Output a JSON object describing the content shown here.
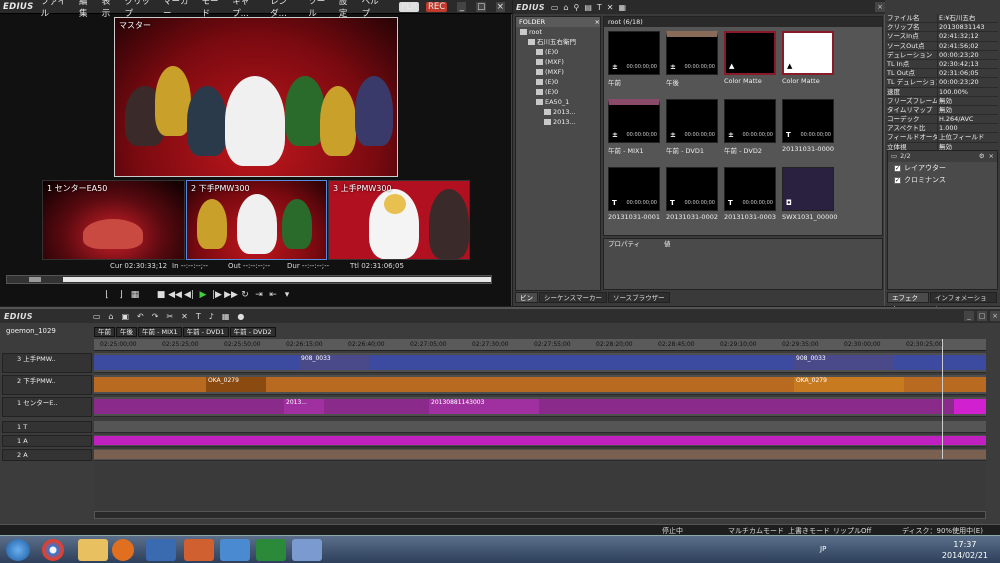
{
  "player": {
    "logo": "EDIUS",
    "menu": [
      "ファイル",
      "編集",
      "表示",
      "クリップ",
      "マーカー",
      "モード",
      "キャプ...",
      "レンダ...",
      "ツール",
      "設定",
      "ヘルプ"
    ],
    "plr": "PLR",
    "rec": "REC",
    "master_label": "マスター",
    "cams": [
      "1 センターEA50",
      "2 下手PMW300",
      "3 上手PMW300"
    ],
    "cur": "Cur 02:30:33;12",
    "in": "In --:--:--;--",
    "out": "Out --:--:--;--",
    "dur": "Dur --:--:--;--",
    "ttl": "Ttl 02:31:06;05"
  },
  "bin": {
    "logo": "EDIUS",
    "folder_title": "FOLDER",
    "tree": [
      "root",
      "石川五右衛門",
      "(E)0",
      "(MXF)",
      "(MXF)",
      "(E)0",
      "(E)0",
      "EA50_1",
      "2013...",
      "2013..."
    ],
    "clip_header": "root (6/18)",
    "clips": [
      {
        "name": "午前",
        "tc": "00:00:00;00"
      },
      {
        "name": "午後",
        "tc": "00:00:00;00"
      },
      {
        "name": "Color Matte",
        "tc": ""
      },
      {
        "name": "Color Matte",
        "tc": ""
      },
      {
        "name": "午前 - MIX1",
        "tc": "00:00:00;00"
      },
      {
        "name": "午前 - DVD1",
        "tc": "00:00:00;00"
      },
      {
        "name": "午前 - DVD2",
        "tc": "00:00:00;00"
      },
      {
        "name": "20131031-0000",
        "tc": "00:00:00;00"
      },
      {
        "name": "20131031-0001",
        "tc": "00:00:00;00"
      },
      {
        "name": "20131031-0002",
        "tc": "00:00:00;00"
      },
      {
        "name": "20131031-0003",
        "tc": "00:00:00;00"
      },
      {
        "name": "SWX1031_00000",
        "tc": ""
      }
    ],
    "prop_col1": "プロパティ",
    "prop_col2": "値",
    "tabs": [
      "ビン",
      "シーケンスマーカー",
      "ソースブラウザー"
    ]
  },
  "info": {
    "rows": [
      {
        "k": "ファイル名",
        "v": "E:¥石川五右"
      },
      {
        "k": "クリップ名",
        "v": "20130831143"
      },
      {
        "k": "ソースIn点",
        "v": "02:41:32;12"
      },
      {
        "k": "ソースOut点",
        "v": "02:41:56;02"
      },
      {
        "k": "デュレーション",
        "v": "00:00:23;20"
      },
      {
        "k": "TL In点",
        "v": "02:30:42;13"
      },
      {
        "k": "TL Out点",
        "v": "02:31:06;05"
      },
      {
        "k": "TL デュレーション",
        "v": "00:00:23;20"
      },
      {
        "k": "速度",
        "v": "100.00%"
      },
      {
        "k": "フリーズフレーム",
        "v": "無効"
      },
      {
        "k": "タイムリマップ",
        "v": "無効"
      },
      {
        "k": "コーデック",
        "v": "H.264/AVC"
      },
      {
        "k": "アスペクト比",
        "v": "1.000"
      },
      {
        "k": "フィールドオーダー",
        "v": "上位フィールド"
      },
      {
        "k": "立体視",
        "v": "無効"
      }
    ],
    "effect_count": "2/2",
    "effects": [
      "レイアウター",
      "クロミナンス"
    ],
    "tabs": [
      "エフェクト",
      "インフォメーション"
    ]
  },
  "timeline": {
    "logo": "EDIUS",
    "project": "goemon_1029",
    "seq_tabs": [
      "午前",
      "午後",
      "午前 - MIX1",
      "午前 - DVD1",
      "午前 - DVD2"
    ],
    "ruler": [
      "02:25:00;00",
      "02:25:25;00",
      "02:25:50;00",
      "02:26:15;00",
      "02:26:40;00",
      "02:27:05;00",
      "02:27:30;00",
      "02:27:55;00",
      "02:28:20;00",
      "02:28:45;00",
      "02:29:10;00",
      "02:29:35;00",
      "02:30:00;00",
      "02:30:25;00"
    ],
    "tracks": [
      {
        "label": "3 上手PMW..",
        "kind": "v"
      },
      {
        "label": "2 下手PMW..",
        "kind": "v"
      },
      {
        "label": "1 センターE..",
        "kind": "v"
      },
      {
        "label": "1 T",
        "kind": "t"
      },
      {
        "label": "1 A",
        "kind": "a"
      },
      {
        "label": "2 A",
        "kind": "a"
      }
    ],
    "clip_names": [
      "908_0033",
      "OKA_0279",
      "2013...",
      "20130881143003"
    ],
    "status": [
      "停止中",
      "マルチカムモード",
      "上書きモード",
      "リップルOff",
      "ディスク：90%使用中(E)"
    ]
  },
  "taskbar": {
    "time": "17:37",
    "date": "2014/02/21",
    "lang": "JP"
  }
}
